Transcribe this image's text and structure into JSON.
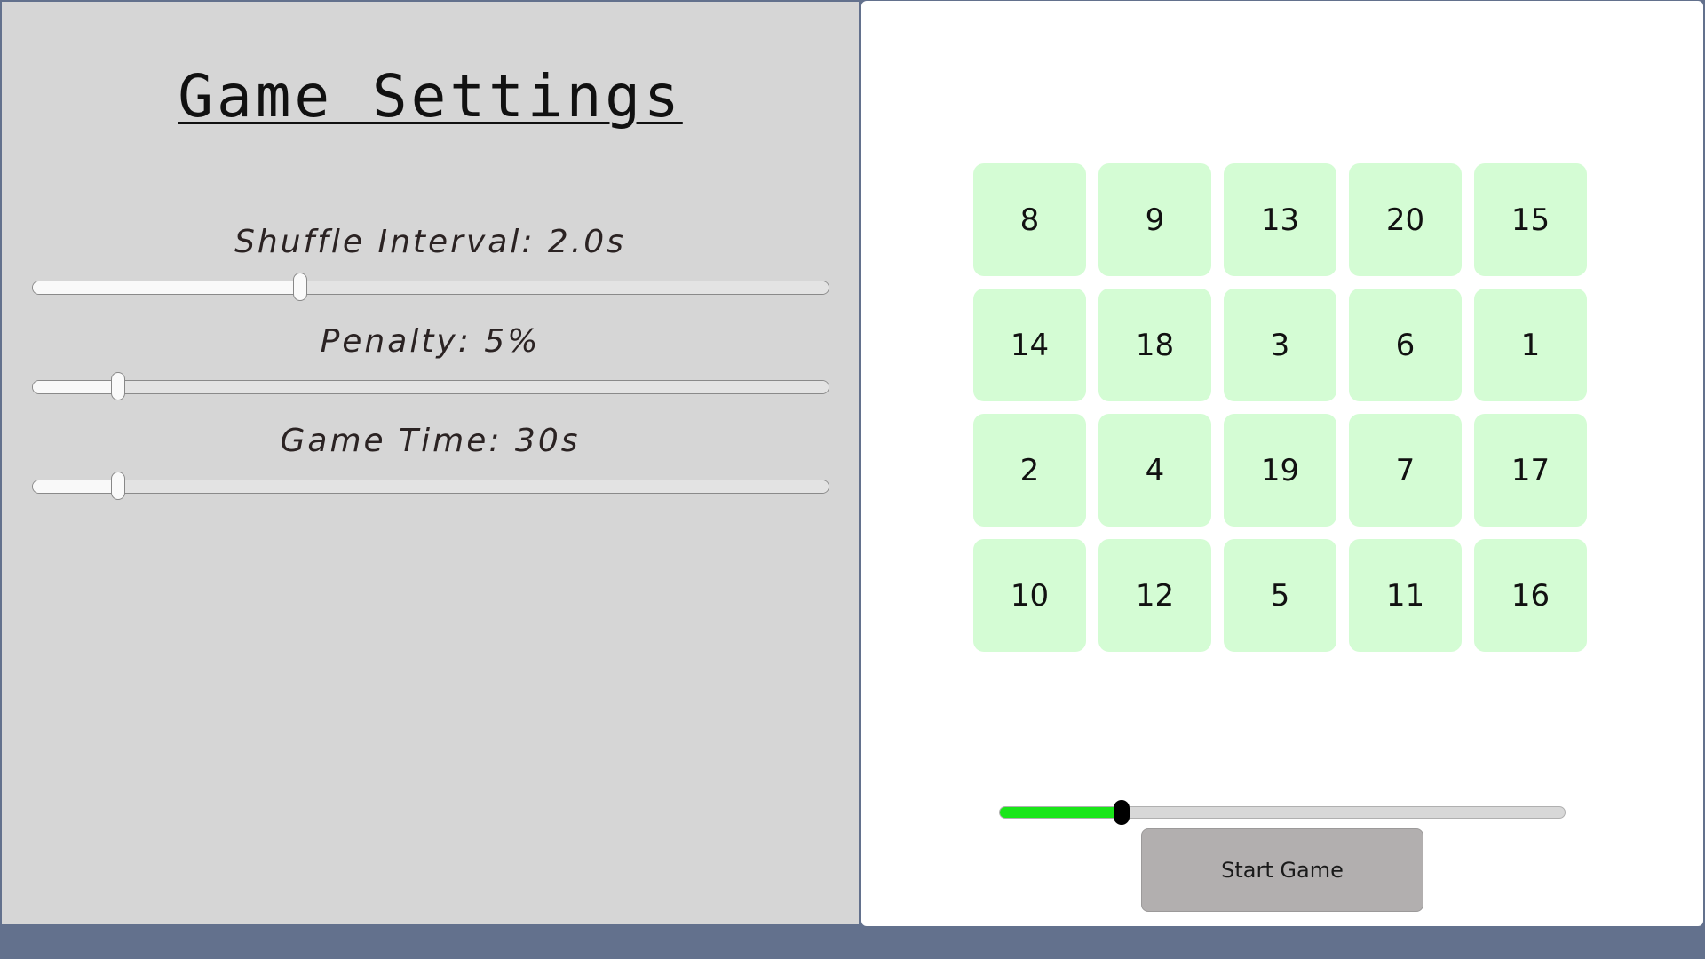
{
  "settings": {
    "title": "Game Settings",
    "sliders": [
      {
        "label": "Shuffle Interval: 2.0s",
        "fraction": 0.336
      },
      {
        "label": "Penalty: 5%",
        "fraction": 0.107
      },
      {
        "label": "Game Time: 30s",
        "fraction": 0.107
      }
    ]
  },
  "board": {
    "tiles": [
      "8",
      "9",
      "13",
      "20",
      "15",
      "14",
      "18",
      "3",
      "6",
      "1",
      "2",
      "4",
      "19",
      "7",
      "17",
      "10",
      "12",
      "5",
      "11",
      "16"
    ]
  },
  "progress": {
    "fraction": 0.216
  },
  "controls": {
    "start_label": "Start Game"
  },
  "colors": {
    "background": "#63718d",
    "settings_panel": "#d6d6d6",
    "tile": "#d4fcd4",
    "progress_fill": "#19e619",
    "button": "#b2afaf"
  }
}
